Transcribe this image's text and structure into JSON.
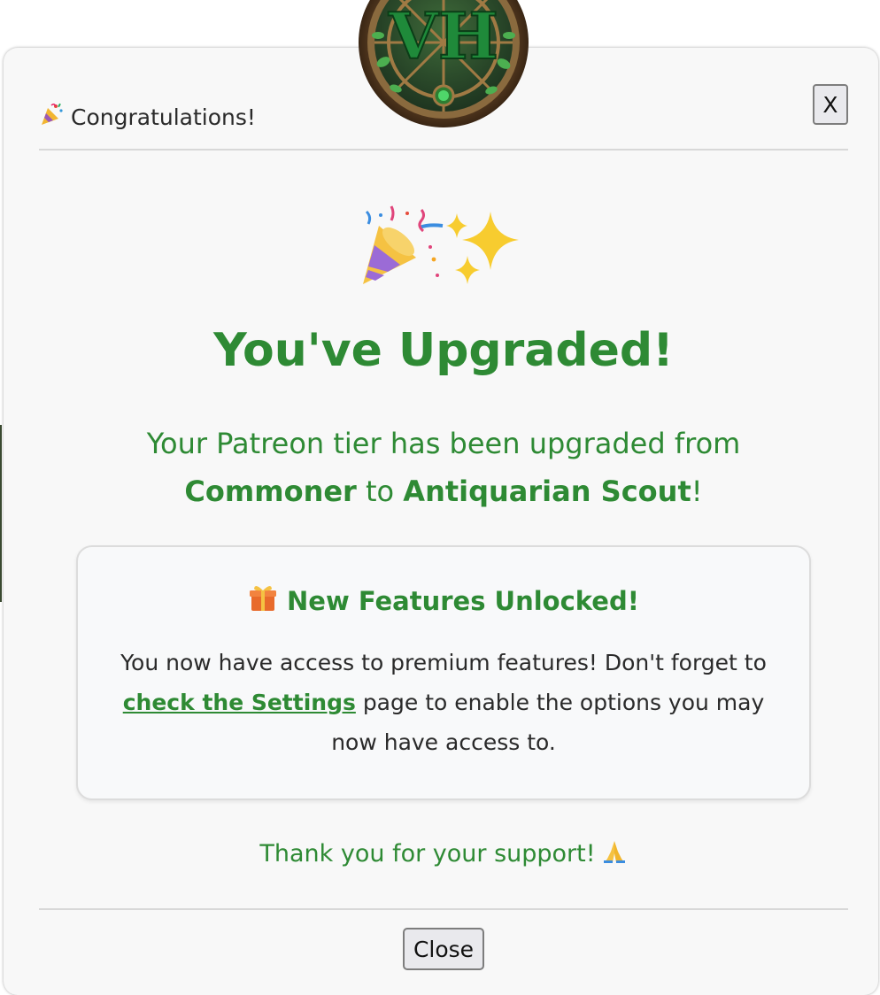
{
  "header": {
    "icon": "party-popper-icon",
    "title": "Congratulations!",
    "close_x_label": "X"
  },
  "emblem": {
    "logo_text": "VH",
    "icon": "vh-emblem-logo"
  },
  "hero": {
    "icons": [
      "party-popper-icon",
      "sparkles-icon"
    ],
    "title": "You've Upgraded!"
  },
  "message": {
    "prefix": "Your Patreon tier has been upgraded from",
    "from_tier": "Commoner",
    "connector": "to",
    "to_tier": "Antiquarian Scout",
    "suffix": "!"
  },
  "features": {
    "icon": "gift-icon",
    "title": "New Features Unlocked!",
    "body_prefix": "You now have access to premium features! Don't forget to",
    "link_text": "check the Settings",
    "body_suffix": "page to enable the options you may now have access to."
  },
  "footer": {
    "thanks": "Thank you for your support!",
    "thanks_icon": "praying-hands-icon",
    "close_label": "Close"
  },
  "colors": {
    "accent_green": "#2e8a34",
    "modal_bg": "#f8f8f8",
    "text_dark": "#2a2a2a"
  }
}
